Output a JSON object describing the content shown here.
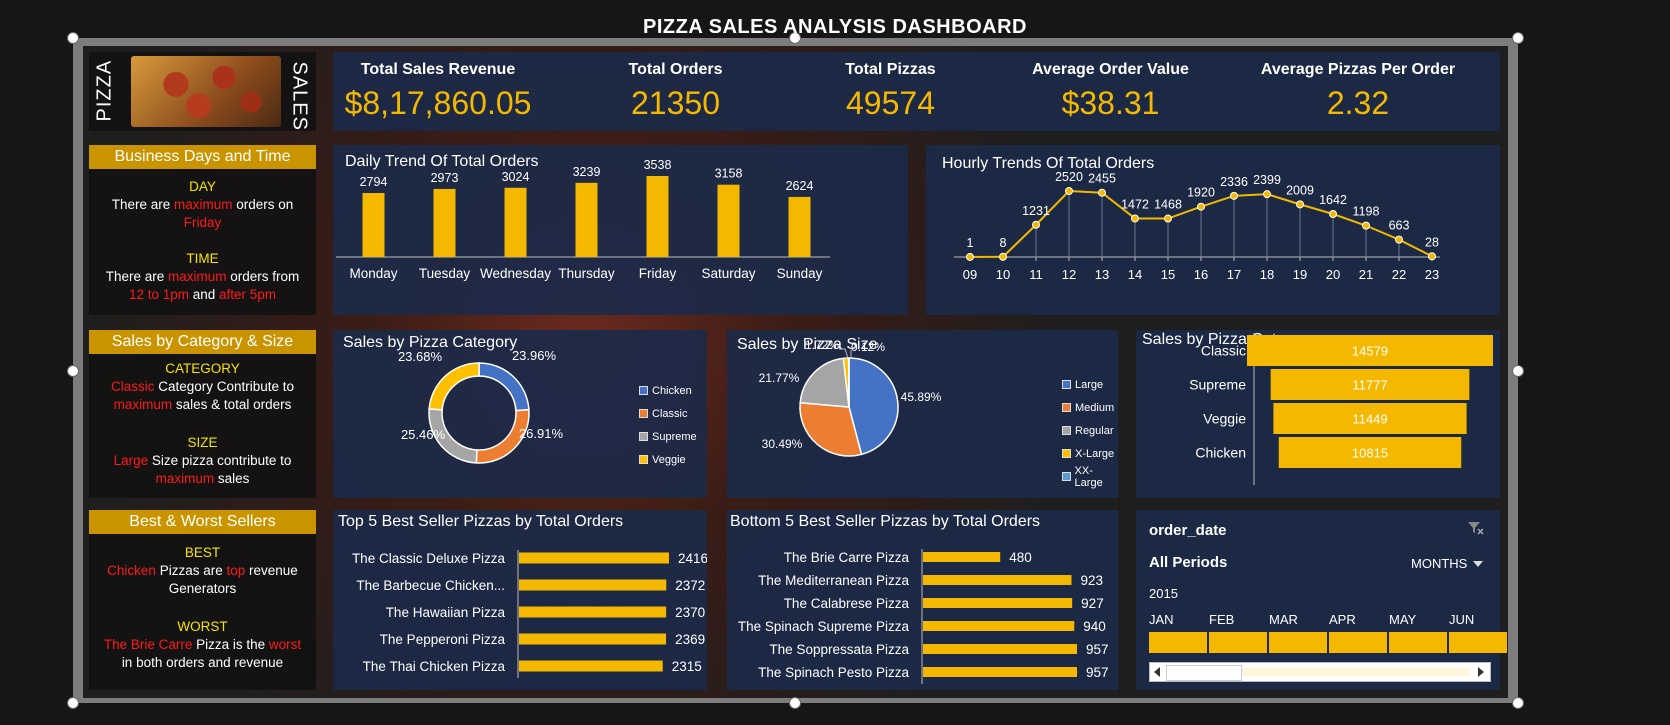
{
  "dashboard_title": "PIZZA SALES ANALYSIS DASHBOARD",
  "logo": {
    "left_text": "PIZZA",
    "right_text": "SALES",
    "image": "pizza-photo"
  },
  "kpis": [
    {
      "label": "Total Sales Revenue",
      "value": "$8,17,860.05"
    },
    {
      "label": "Total Orders",
      "value": "21350"
    },
    {
      "label": "Total Pizzas",
      "value": "49574"
    },
    {
      "label": "Average Order Value",
      "value": "$38.31"
    },
    {
      "label": "Average Pizzas Per Order",
      "value": "2.32"
    }
  ],
  "insights": {
    "days_time": {
      "header": "Business  Days and Time",
      "day_title": "DAY",
      "day_p1": "There are ",
      "day_red1": "maximum",
      "day_p2": " orders on",
      "day_red2": "Friday",
      "time_title": "TIME",
      "time_p1": "There are ",
      "time_red1": "maximum",
      "time_p2": " orders from",
      "time_red2": "12 to 1pm",
      "time_p3": " and ",
      "time_red3": "after 5pm"
    },
    "category_size": {
      "header": "Sales by Category & Size",
      "cat_title": "CATEGORY",
      "cat_red1": "Classic",
      "cat_p1": " Category Contribute to",
      "cat_red2": "maximum",
      "cat_p2": " sales & total orders",
      "size_title": "SIZE",
      "size_red1": "Large",
      "size_p1": " Size pizza contribute to",
      "size_red2": "maximum",
      "size_p2": " sales"
    },
    "best_worst": {
      "header": "Best & Worst Sellers",
      "best_title": "BEST",
      "best_red1": "Chicken",
      "best_p1": " Pizzas are ",
      "best_red2": "top",
      "best_p2": " revenue",
      "best_p3": "Generators",
      "worst_title": "WORST",
      "worst_red1": "The Brie Carre",
      "worst_p1": " Pizza is the ",
      "worst_red2": "worst",
      "worst_p2": "in both orders and revenue"
    }
  },
  "colors": {
    "accent": "#f5b800",
    "panel": "#1c2a48",
    "gold_header": "#c99400",
    "red_text": "#ff1a1a",
    "yellow_text": "#f5e300"
  },
  "panels": {
    "daily": "Daily Trend Of Total Orders",
    "hourly": "Hourly Trends Of Total Orders",
    "pie_cat": "Sales by Pizza Category",
    "pie_size": "Sales by Pizza Size",
    "bar_cat": "Sales by Pizza Category",
    "top5": "Top 5 Best Seller Pizzas by Total Orders",
    "bottom5": "Bottom 5 Best Seller Pizzas by Total Orders"
  },
  "timeline": {
    "field": "order_date",
    "selection": "All Periods",
    "level": "MONTHS",
    "year": "2015",
    "months": [
      "JAN",
      "FEB",
      "MAR",
      "APR",
      "MAY",
      "JUN"
    ],
    "filter_icon": "clear-filter-icon"
  },
  "chart_data": [
    {
      "type": "bar",
      "title": "Daily Trend Of Total Orders",
      "categories": [
        "Monday",
        "Tuesday",
        "Wednesday",
        "Thursday",
        "Friday",
        "Saturday",
        "Sunday"
      ],
      "values": [
        2794,
        2973,
        3024,
        3239,
        3538,
        3158,
        2624
      ],
      "color": "#f5b800"
    },
    {
      "type": "line",
      "title": "Hourly Trends Of Total Orders",
      "categories": [
        "09",
        "10",
        "11",
        "12",
        "13",
        "14",
        "15",
        "16",
        "17",
        "18",
        "19",
        "20",
        "21",
        "22",
        "23"
      ],
      "values": [
        1,
        8,
        1231,
        2520,
        2455,
        1472,
        1468,
        1920,
        2336,
        2399,
        2009,
        1642,
        1198,
        663,
        28
      ],
      "color": "#f5b800"
    },
    {
      "type": "pie",
      "title": "Sales by Pizza Category",
      "donut": true,
      "categories": [
        "Chicken",
        "Classic",
        "Supreme",
        "Veggie"
      ],
      "values": [
        23.96,
        26.91,
        25.46,
        23.68
      ],
      "labels": [
        "23.96%",
        "26.91%",
        "25.46%",
        "23.68%"
      ],
      "colors": [
        "#4472c4",
        "#ed7d31",
        "#a5a5a5",
        "#ffc000"
      ],
      "legend": "right"
    },
    {
      "type": "pie",
      "title": "Sales by Pizza Size",
      "categories": [
        "Large",
        "Medium",
        "Regular",
        "X-Large",
        "XX-Large"
      ],
      "values": [
        45.89,
        30.49,
        21.77,
        1.72,
        0.12
      ],
      "labels": [
        "45.89%",
        "30.49%",
        "21.77%",
        "1.72%",
        "0.12%"
      ],
      "colors": [
        "#4472c4",
        "#ed7d31",
        "#a5a5a5",
        "#ffc000",
        "#5b9bd5"
      ],
      "legend": "right"
    },
    {
      "type": "bar",
      "orientation": "horizontal",
      "title": "Sales by Pizza Category",
      "categories": [
        "Classic",
        "Supreme",
        "Veggie",
        "Chicken"
      ],
      "values": [
        14579,
        11777,
        11449,
        10815
      ],
      "color": "#f5b800"
    },
    {
      "type": "bar",
      "orientation": "horizontal",
      "title": "Top 5 Best Seller Pizzas by Total Orders",
      "categories": [
        "The Classic Deluxe Pizza",
        "The Barbecue Chicken...",
        "The Hawaiian Pizza",
        "The Pepperoni Pizza",
        "The Thai Chicken Pizza"
      ],
      "values": [
        2416,
        2372,
        2370,
        2369,
        2315
      ],
      "color": "#f5b800"
    },
    {
      "type": "bar",
      "orientation": "horizontal",
      "title": "Bottom 5 Best Seller Pizzas by Total Orders",
      "categories": [
        "The Brie Carre Pizza",
        "The Mediterranean Pizza",
        "The Calabrese Pizza",
        "The Spinach Supreme Pizza",
        "The Soppressata Pizza",
        "The Spinach Pesto Pizza"
      ],
      "values": [
        480,
        923,
        927,
        940,
        957,
        957
      ],
      "color": "#f5b800"
    }
  ]
}
